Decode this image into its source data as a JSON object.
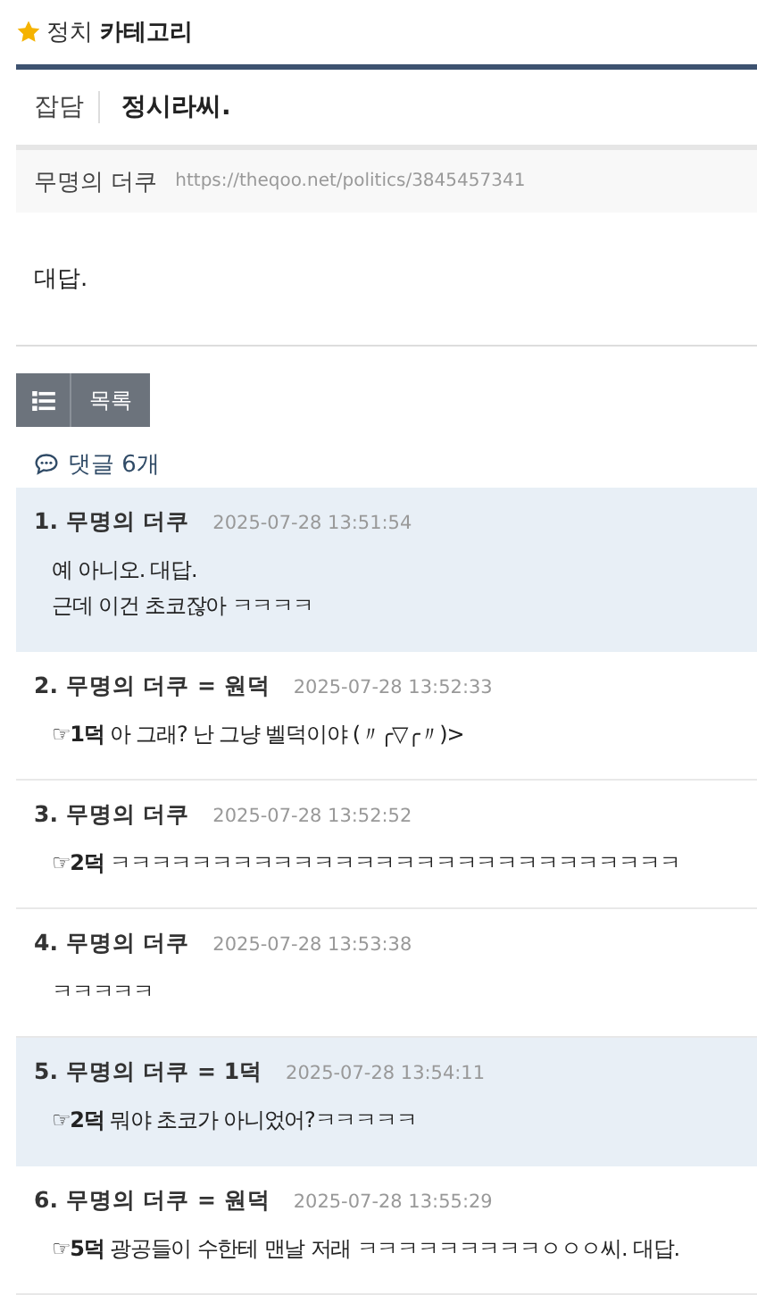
{
  "category": {
    "board": "정치",
    "label": "카테고리"
  },
  "post": {
    "tag": "잡담",
    "title": "정시라씨.",
    "author": "무명의 더쿠",
    "url": "https://theqoo.net/politics/3845457341",
    "body": "대답."
  },
  "list_button": {
    "label": "목록"
  },
  "comment_count": "댓글 6개",
  "comments": [
    {
      "header": "1. 무명의 더쿠",
      "date": "2025-07-28 13:51:54",
      "highlighted": true,
      "lines": [
        "예 아니오. 대답.",
        "근데 이건 초코잖아 ㅋㅋㅋㅋ"
      ]
    },
    {
      "header": "2. 무명의 더쿠 = 원덕",
      "date": "2025-07-28 13:52:33",
      "highlighted": false,
      "lines": [
        "**☞1덕** 아 그래? 난 그냥 벨덕이야 (〃╭▽╭〃)>"
      ]
    },
    {
      "header": "3. 무명의 더쿠",
      "date": "2025-07-28 13:52:52",
      "highlighted": false,
      "lines": [
        "**☞2덕** ㅋㅋㅋㅋㅋㅋㅋㅋㅋㅋㅋㅋㅋㅋㅋㅋㅋㅋㅋㅋㅋㅋㅋㅋㅋㅋㅋㅋ"
      ]
    },
    {
      "header": "4. 무명의 더쿠",
      "date": "2025-07-28 13:53:38",
      "highlighted": false,
      "lines": [
        "ㅋㅋㅋㅋㅋ"
      ]
    },
    {
      "header": "5. 무명의 더쿠 = 1덕",
      "date": "2025-07-28 13:54:11",
      "highlighted": true,
      "lines": [
        "**☞2덕** 뭐야 초코가 아니었어?ㅋㅋㅋㅋㅋ"
      ]
    },
    {
      "header": "6. 무명의 더쿠 = 원덕",
      "date": "2025-07-28 13:55:29",
      "highlighted": false,
      "lines": [
        "**☞5덕** 광공들이 수한테 맨날 저래 ㅋㅋㅋㅋㅋㅋㅋㅋㅋㅇㅇㅇ씨. 대답."
      ]
    }
  ]
}
